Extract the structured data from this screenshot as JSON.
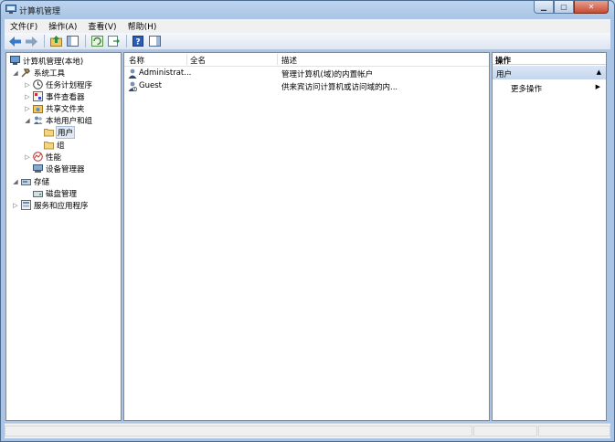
{
  "window": {
    "title": "计算机管理"
  },
  "menu": [
    {
      "label": "文件(F)"
    },
    {
      "label": "操作(A)"
    },
    {
      "label": "查看(V)"
    },
    {
      "label": "帮助(H)"
    }
  ],
  "toolbar": [
    "back-icon",
    "forward-icon",
    "up-folder-icon",
    "show-hide-tree-icon",
    "refresh-icon",
    "export-list-icon",
    "help-icon",
    "properties-pane-icon"
  ],
  "tree": [
    {
      "label": "计算机管理(本地)",
      "icon": "computer-management-icon",
      "expander": ""
    },
    {
      "label": "系统工具",
      "icon": "system-tools-icon",
      "expander": "◢"
    },
    {
      "label": "任务计划程序",
      "icon": "task-scheduler-icon",
      "expander": "▷"
    },
    {
      "label": "事件查看器",
      "icon": "event-viewer-icon",
      "expander": "▷"
    },
    {
      "label": "共享文件夹",
      "icon": "shared-folders-icon",
      "expander": "▷"
    },
    {
      "label": "本地用户和组",
      "icon": "local-users-groups-icon",
      "expander": "◢"
    },
    {
      "label": "用户",
      "icon": "folder-icon",
      "expander": ""
    },
    {
      "label": "组",
      "icon": "folder-icon",
      "expander": ""
    },
    {
      "label": "性能",
      "icon": "performance-icon",
      "expander": "▷"
    },
    {
      "label": "设备管理器",
      "icon": "device-manager-icon",
      "expander": ""
    },
    {
      "label": "存储",
      "icon": "storage-icon",
      "expander": "◢"
    },
    {
      "label": "磁盘管理",
      "icon": "disk-management-icon",
      "expander": ""
    },
    {
      "label": "服务和应用程序",
      "icon": "services-apps-icon",
      "expander": "▷"
    }
  ],
  "list": {
    "columns": [
      "名称",
      "全名",
      "描述"
    ],
    "rows": [
      {
        "name": "Administrat...",
        "fullname": "",
        "description": "管理计算机(域)的内置帐户"
      },
      {
        "name": "Guest",
        "fullname": "",
        "description": "供来宾访问计算机或访问域的内..."
      }
    ]
  },
  "actions": {
    "title": "操作",
    "group": "用户",
    "item": "更多操作"
  }
}
